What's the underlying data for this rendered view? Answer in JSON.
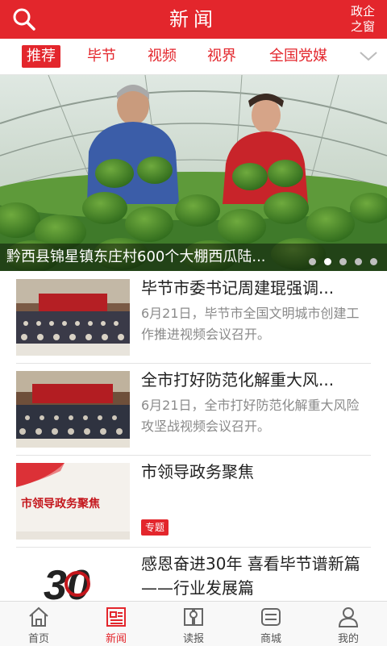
{
  "header": {
    "title": "新闻",
    "corner_line1": "政企",
    "corner_line2": "之窗"
  },
  "tabs": [
    {
      "label": "推荐"
    },
    {
      "label": "毕节"
    },
    {
      "label": "视频"
    },
    {
      "label": "视界"
    },
    {
      "label": "全国党媒"
    }
  ],
  "banner": {
    "caption": "黔西县锦星镇东庄村600个大棚西瓜陆...",
    "slides": 5,
    "active_slide": 2
  },
  "news": [
    {
      "title": "毕节市委书记周建琨强调...",
      "summary": "6月21日，毕节市全国文明城市创建工作推进视频会议召开。"
    },
    {
      "title": "全市打好防范化解重大风...",
      "summary": "6月21日，全市打好防范化解重大风险攻坚战视频会议召开。"
    },
    {
      "title": "市领导政务聚焦",
      "badge": "专题",
      "thumb_text": "市领导政务聚焦"
    },
    {
      "title": "感恩奋进30年 喜看毕节谱新篇——行业发展篇",
      "thumb_text": "30"
    }
  ],
  "bottom_nav": [
    {
      "label": "首页",
      "icon": "home-icon"
    },
    {
      "label": "新闻",
      "icon": "news-icon"
    },
    {
      "label": "读报",
      "icon": "newspaper-icon"
    },
    {
      "label": "商城",
      "icon": "mall-icon"
    },
    {
      "label": "我的",
      "icon": "user-icon"
    }
  ],
  "colors": {
    "brand": "#e3262c",
    "inactive": "#555555"
  }
}
